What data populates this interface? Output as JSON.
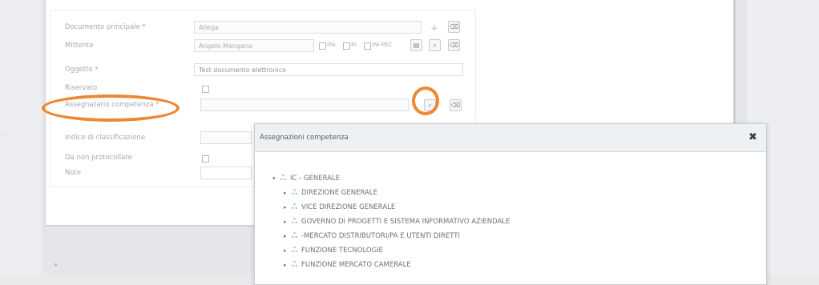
{
  "form": {
    "rows": [
      {
        "label": "Documento principale *",
        "value": "Allega"
      },
      {
        "label": "Mittente",
        "value": "Angelo Mangano",
        "options": [
          "IPA",
          "RI",
          "INI-PEC"
        ]
      },
      {
        "label": "Oggetto *",
        "value": "Test documento elettronico"
      },
      {
        "label": "Riservato",
        "value": ""
      },
      {
        "label": "Assegnatario competenza *",
        "value": ""
      },
      {
        "label": "Indice di classificazione",
        "value": ""
      },
      {
        "label": "Da non protocollare",
        "value": ""
      },
      {
        "label": "Note",
        "value": ""
      }
    ]
  },
  "annotations": {
    "highlight_color": "#ef8732"
  },
  "modal": {
    "title": "Assegnazioni competenza",
    "close_label": "✖",
    "tree": {
      "root": "IC - GENERALE",
      "children": [
        "DIREZIONE GENERALE",
        "VICE DIREZIONE GENERALE",
        "GOVERNO DI PROGETTI E SISTEMA INFORMATIVO AZIENDALE",
        "-MERCATO DISTRIBUTORI/PA E UTENTI DIRETTI",
        "FUNZIONE TECNOLOGIE",
        "FUNZIONE MERCATO CAMERALE"
      ]
    }
  },
  "icons": {
    "tree_node": "org-unit-icon",
    "expand": "chevron-right-icon",
    "collapse": "chevron-down-icon"
  }
}
